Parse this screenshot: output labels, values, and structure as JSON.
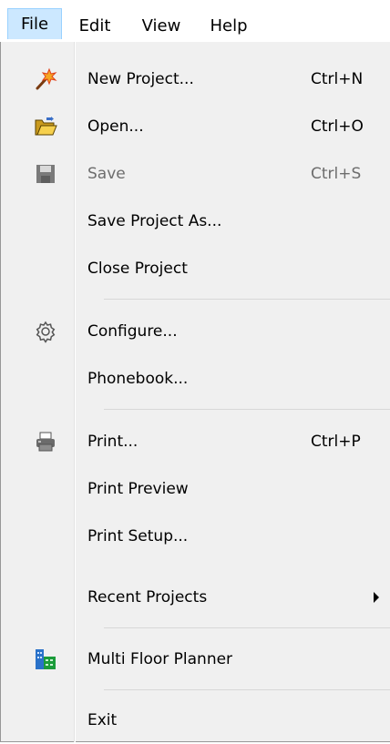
{
  "menubar": {
    "file": "File",
    "edit": "Edit",
    "view": "View",
    "help": "Help"
  },
  "file_menu": {
    "new_project": {
      "label": "New Project...",
      "shortcut": "Ctrl+N",
      "icon": "wand-icon"
    },
    "open": {
      "label": "Open...",
      "shortcut": "Ctrl+O",
      "icon": "open-folder-icon"
    },
    "save": {
      "label": "Save",
      "shortcut": "Ctrl+S",
      "icon": "save-disk-icon",
      "enabled": false
    },
    "save_project_as": {
      "label": "Save Project As..."
    },
    "close_project": {
      "label": "Close Project"
    },
    "configure": {
      "label": "Configure...",
      "icon": "gear-icon"
    },
    "phonebook": {
      "label": "Phonebook..."
    },
    "print": {
      "label": "Print...",
      "shortcut": "Ctrl+P",
      "icon": "printer-icon"
    },
    "print_preview": {
      "label": "Print Preview"
    },
    "print_setup": {
      "label": "Print Setup..."
    },
    "recent_projects": {
      "label": "Recent Projects",
      "has_submenu": true
    },
    "multi_floor_planner": {
      "label": "Multi Floor Planner",
      "icon": "building-icon"
    },
    "exit": {
      "label": "Exit"
    }
  },
  "colors": {
    "menu_background": "#f0f0f0",
    "active_menu_highlight": "#cce8ff",
    "active_menu_border": "#99d1ff",
    "disabled_text": "#6d6d6d",
    "separator": "#d7d7d7"
  }
}
